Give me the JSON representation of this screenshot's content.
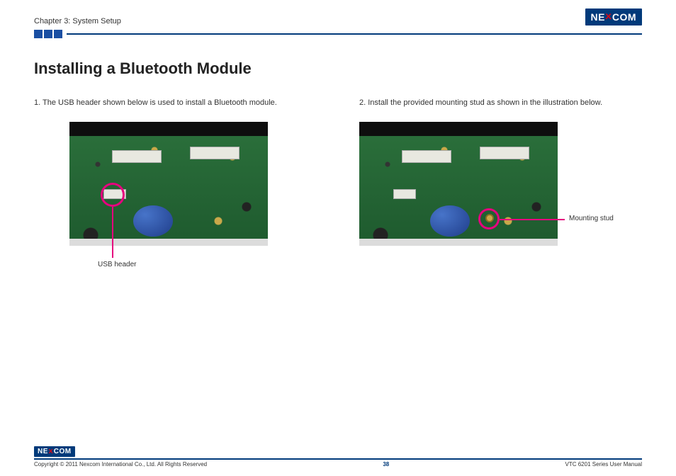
{
  "header": {
    "chapter": "Chapter 3: System Setup",
    "logo_main": "NE",
    "logo_mid": "X",
    "logo_end": "COM"
  },
  "page": {
    "title": "Installing a Bluetooth Module",
    "step1": "1. The USB header shown below is used to install a Bluetooth module.",
    "step2": "2. Install the provided mounting stud as shown in the illustration below.",
    "label_usb": "USB header",
    "label_stud": "Mounting stud"
  },
  "footer": {
    "copyright": "Copyright © 2011 Nexcom International Co., Ltd. All Rights Reserved",
    "page_number": "38",
    "manual": "VTC 6201 Series User Manual"
  }
}
